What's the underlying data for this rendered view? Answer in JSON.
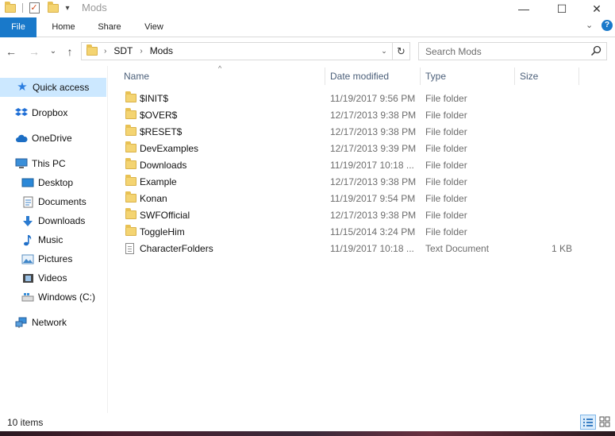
{
  "window": {
    "title": "Mods",
    "minimize_glyph": "—",
    "maximize_glyph": "☐",
    "close_glyph": "✕"
  },
  "ribbon": {
    "tabs": [
      "File",
      "Home",
      "Share",
      "View"
    ],
    "expand_glyph": "⌄",
    "help_glyph": "?"
  },
  "nav": {
    "back_glyph": "←",
    "forward_glyph": "→",
    "recent_glyph": "⌄",
    "up_glyph": "↑",
    "breadcrumbs": [
      "SDT",
      "Mods"
    ],
    "breadcrumb_sep": "›",
    "refresh_glyph": "↻"
  },
  "search": {
    "placeholder": "Search Mods"
  },
  "sidebar": {
    "items": [
      {
        "label": "Quick access",
        "icon": "star-icon"
      },
      {
        "label": "Dropbox",
        "icon": "dropbox-icon"
      },
      {
        "label": "OneDrive",
        "icon": "cloud-icon"
      },
      {
        "label": "This PC",
        "icon": "computer-icon"
      },
      {
        "label": "Desktop",
        "icon": "desktop-icon"
      },
      {
        "label": "Documents",
        "icon": "documents-icon"
      },
      {
        "label": "Downloads",
        "icon": "download-icon"
      },
      {
        "label": "Music",
        "icon": "music-icon"
      },
      {
        "label": "Pictures",
        "icon": "pictures-icon"
      },
      {
        "label": "Videos",
        "icon": "videos-icon"
      },
      {
        "label": "Windows (C:)",
        "icon": "drive-icon"
      },
      {
        "label": "Network",
        "icon": "network-icon"
      }
    ]
  },
  "columns": {
    "name": "Name",
    "date": "Date modified",
    "type": "Type",
    "size": "Size",
    "sort_glyph": "^"
  },
  "files": [
    {
      "name": "$INIT$",
      "date": "11/19/2017 9:56 PM",
      "type": "File folder",
      "size": "",
      "kind": "folder"
    },
    {
      "name": "$OVER$",
      "date": "12/17/2013 9:38 PM",
      "type": "File folder",
      "size": "",
      "kind": "folder"
    },
    {
      "name": "$RESET$",
      "date": "12/17/2013 9:38 PM",
      "type": "File folder",
      "size": "",
      "kind": "folder"
    },
    {
      "name": "DevExamples",
      "date": "12/17/2013 9:39 PM",
      "type": "File folder",
      "size": "",
      "kind": "folder"
    },
    {
      "name": "Downloads",
      "date": "11/19/2017 10:18 ...",
      "type": "File folder",
      "size": "",
      "kind": "folder"
    },
    {
      "name": "Example",
      "date": "12/17/2013 9:38 PM",
      "type": "File folder",
      "size": "",
      "kind": "folder"
    },
    {
      "name": "Konan",
      "date": "11/19/2017 9:54 PM",
      "type": "File folder",
      "size": "",
      "kind": "folder"
    },
    {
      "name": "SWFOfficial",
      "date": "12/17/2013 9:38 PM",
      "type": "File folder",
      "size": "",
      "kind": "folder"
    },
    {
      "name": "ToggleHim",
      "date": "11/15/2014 3:24 PM",
      "type": "File folder",
      "size": "",
      "kind": "folder"
    },
    {
      "name": "CharacterFolders",
      "date": "11/19/2017 10:18 ...",
      "type": "Text Document",
      "size": "1 KB",
      "kind": "document"
    }
  ],
  "status": {
    "item_count": "10 items"
  },
  "colors": {
    "file_tab": "#1979ca",
    "selected_nav": "#cce8ff",
    "folder": "#f4d472",
    "header_text": "#4c607a"
  }
}
